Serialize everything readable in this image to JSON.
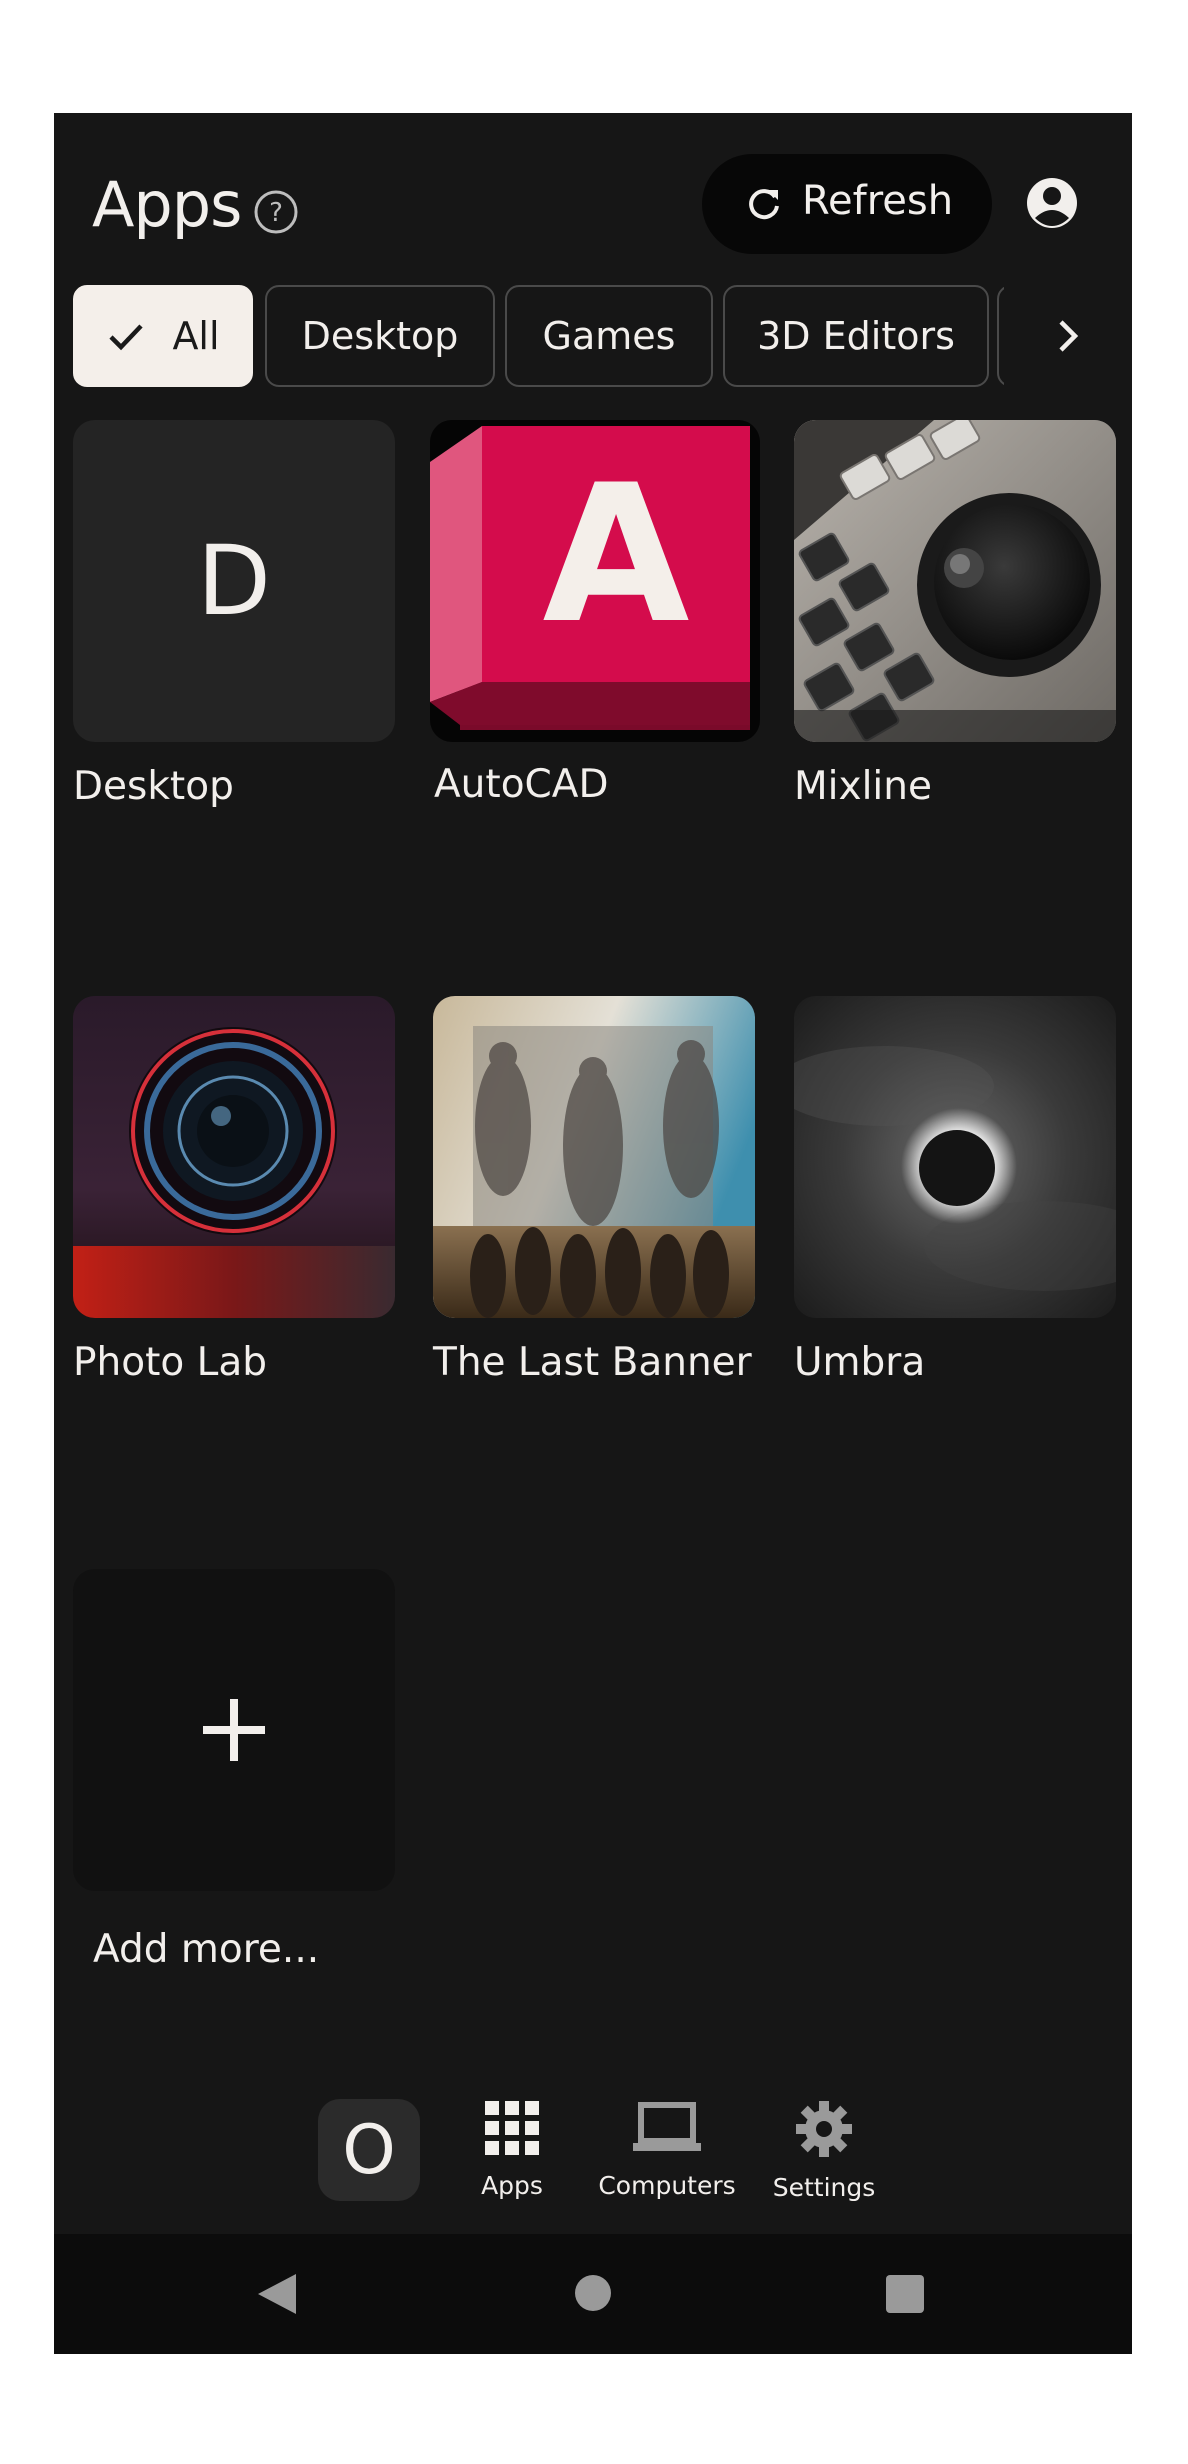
{
  "header": {
    "title": "Apps",
    "refresh_label": "Refresh"
  },
  "filters": [
    {
      "label": "All",
      "active": true
    },
    {
      "label": "Desktop",
      "active": false
    },
    {
      "label": "Games",
      "active": false
    },
    {
      "label": "3D Editors",
      "active": false
    }
  ],
  "apps": [
    {
      "name": "Desktop",
      "icon": "letter-d-tile",
      "letter": "D"
    },
    {
      "name": "AutoCAD",
      "icon": "autocad-logo",
      "letter": "A"
    },
    {
      "name": "Mixline",
      "icon": "control-panel-photo"
    },
    {
      "name": "Photo Lab",
      "icon": "camera-lens-photo"
    },
    {
      "name": "The Last Banner",
      "icon": "warriors-artwork"
    },
    {
      "name": "Umbra",
      "icon": "eclipse-photo"
    }
  ],
  "add_more": {
    "label": "Add more..."
  },
  "bottom_nav": {
    "home_letter": "O",
    "items": [
      {
        "label": "Apps",
        "icon": "grid-icon"
      },
      {
        "label": "Computers",
        "icon": "laptop-icon"
      },
      {
        "label": "Settings",
        "icon": "gear-icon"
      }
    ]
  },
  "colors": {
    "background": "#161616",
    "text": "#f2efec",
    "chip_active": "#f4efea",
    "autocad_red": "#d40c4c"
  }
}
